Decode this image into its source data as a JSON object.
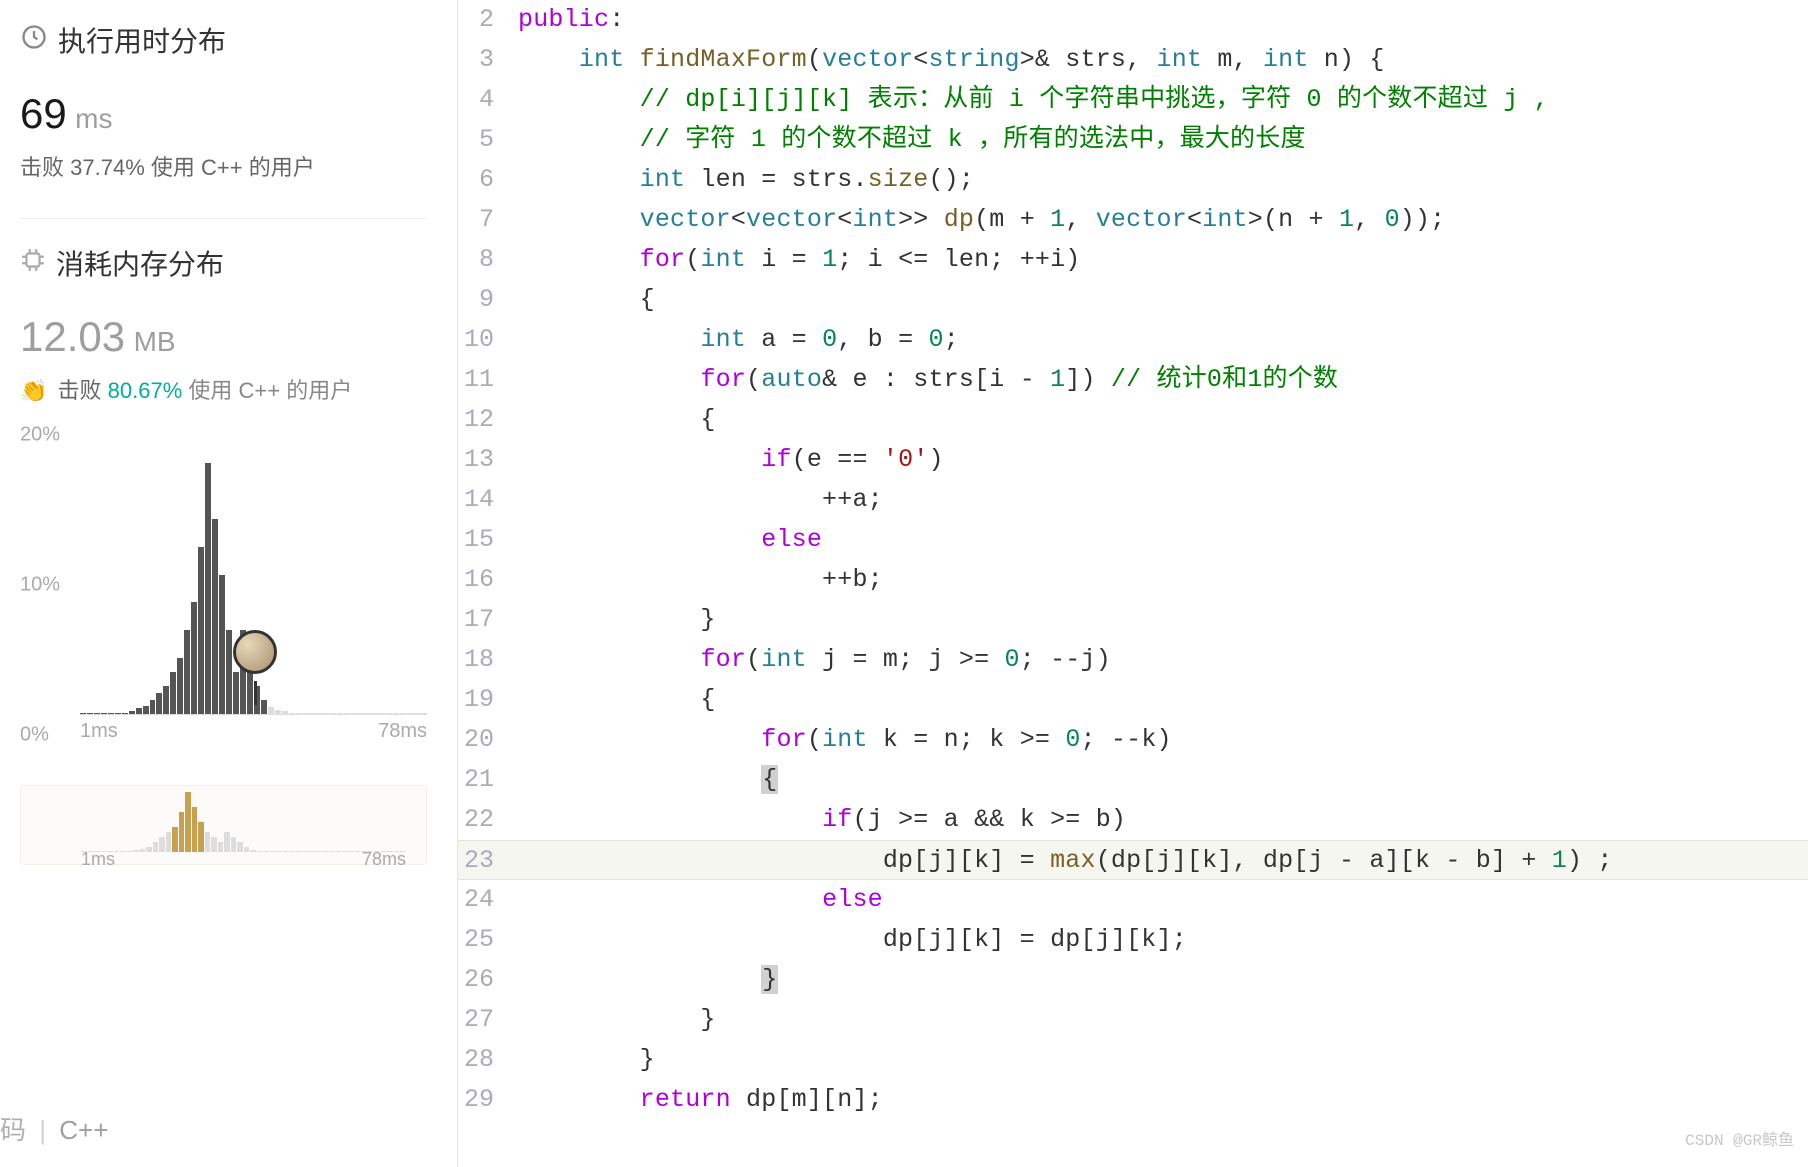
{
  "runtime": {
    "title": "执行用时分布",
    "value": "69",
    "unit": "ms",
    "beat_label": "击败",
    "beat_pct": "37.74%",
    "suffix": "使用 C++ 的用户"
  },
  "memory": {
    "title": "消耗内存分布",
    "value": "12.03",
    "unit": "MB",
    "beat_label": "击败",
    "beat_pct": "80.67%",
    "suffix": "使用 C++ 的用户"
  },
  "chart": {
    "y_labels": [
      "20%",
      "10%",
      "0%"
    ],
    "x_min": "1ms",
    "x_max": "78ms",
    "mini_x_min": "1ms",
    "mini_x_max": "78ms"
  },
  "bottom_tabs": {
    "ma": "码",
    "cpp": "C++"
  },
  "code": {
    "lines": [
      {
        "n": "2",
        "html": "<span class='kw'>public</span>:"
      },
      {
        "n": "3",
        "html": "    <span class='type'>int</span> <span class='func'>findMaxForm</span>(<span class='type'>vector</span>&lt;<span class='type'>string</span>&gt;&amp; strs, <span class='type'>int</span> m, <span class='type'>int</span> n) {"
      },
      {
        "n": "4",
        "html": "        <span class='comment'>// dp[i][j][k] 表示：从前 i 个字符串中挑选，字符 0 的个数不超过 j ,</span>"
      },
      {
        "n": "5",
        "html": "        <span class='comment'>// 字符 1 的个数不超过 k ，所有的选法中，最大的长度</span>"
      },
      {
        "n": "6",
        "html": "        <span class='type'>int</span> len = strs.<span class='func'>size</span>();"
      },
      {
        "n": "7",
        "html": "        <span class='type'>vector</span>&lt;<span class='type'>vector</span>&lt;<span class='type'>int</span>&gt;&gt; <span class='func'>dp</span>(m + <span class='num'>1</span>, <span class='type'>vector</span>&lt;<span class='type'>int</span>&gt;(n + <span class='num'>1</span>, <span class='num'>0</span>));"
      },
      {
        "n": "8",
        "html": "        <span class='kw'>for</span>(<span class='type'>int</span> i = <span class='num'>1</span>; i &lt;= len; ++i)"
      },
      {
        "n": "9",
        "html": "        {"
      },
      {
        "n": "10",
        "html": "            <span class='type'>int</span> a = <span class='num'>0</span>, b = <span class='num'>0</span>;"
      },
      {
        "n": "11",
        "html": "            <span class='kw'>for</span>(<span class='type'>auto</span>&amp; e : strs[i - <span class='num'>1</span>]) <span class='comment'>// 统计0和1的个数</span>"
      },
      {
        "n": "12",
        "html": "            {"
      },
      {
        "n": "13",
        "html": "                <span class='kw'>if</span>(e == <span class='str'>'0'</span>)"
      },
      {
        "n": "14",
        "html": "                    ++a;"
      },
      {
        "n": "15",
        "html": "                <span class='kw'>else</span>"
      },
      {
        "n": "16",
        "html": "                    ++b;"
      },
      {
        "n": "17",
        "html": "            }"
      },
      {
        "n": "18",
        "html": "            <span class='kw'>for</span>(<span class='type'>int</span> j = m; j &gt;= <span class='num'>0</span>; --j)"
      },
      {
        "n": "19",
        "html": "            {"
      },
      {
        "n": "20",
        "html": "                <span class='kw'>for</span>(<span class='type'>int</span> k = n; k &gt;= <span class='num'>0</span>; --k)"
      },
      {
        "n": "21",
        "html": "                <span class='cursor-highlight'>{</span>"
      },
      {
        "n": "22",
        "html": "                    <span class='kw'>if</span>(j &gt;= a &amp;&amp; k &gt;= b)"
      },
      {
        "n": "23",
        "highlight": true,
        "html": "                        dp[j][k] = <span class='func'>max</span>(dp[j][k], dp[j - a][k - b] + <span class='num'>1</span>) ;"
      },
      {
        "n": "24",
        "html": "                    <span class='kw'>else</span>"
      },
      {
        "n": "25",
        "html": "                        dp[j][k] = dp[j][k];"
      },
      {
        "n": "26",
        "html": "                <span class='cursor-highlight'>}</span>"
      },
      {
        "n": "27",
        "html": "            }"
      },
      {
        "n": "28",
        "html": "        }"
      },
      {
        "n": "29",
        "html": "        <span class='kw'>return</span> dp[m][n];"
      }
    ]
  },
  "watermark": "CSDN @GR鲸鱼",
  "chart_data": {
    "type": "bar",
    "title": "执行用时分布",
    "xlabel": "ms",
    "ylabel": "percent",
    "ylim": [
      0,
      20
    ],
    "x_range": [
      1,
      78
    ],
    "main_bars_pct": [
      0,
      0,
      0,
      0,
      0,
      0,
      0,
      0.2,
      0.4,
      0.6,
      1,
      1.5,
      2,
      3,
      4,
      6,
      8,
      12,
      18,
      14,
      10,
      6,
      3,
      6,
      4,
      2,
      1,
      0.5,
      0.3,
      0.2,
      0,
      0,
      0,
      0,
      0,
      0,
      0,
      0,
      0,
      0,
      0,
      0,
      0,
      0,
      0,
      0,
      0,
      0,
      0,
      0
    ],
    "user_marker_ms": 69,
    "mini_bars_pct": [
      0,
      0,
      0,
      0,
      0,
      0,
      0,
      0.2,
      0.4,
      0.6,
      1,
      2,
      3,
      4,
      5,
      8,
      12,
      9,
      6,
      4,
      3,
      2,
      4,
      3,
      2,
      1,
      0.5,
      0.3,
      0.2,
      0,
      0,
      0,
      0,
      0,
      0,
      0,
      0,
      0,
      0,
      0,
      0,
      0,
      0,
      0,
      0,
      0,
      0,
      0,
      0,
      0
    ]
  }
}
